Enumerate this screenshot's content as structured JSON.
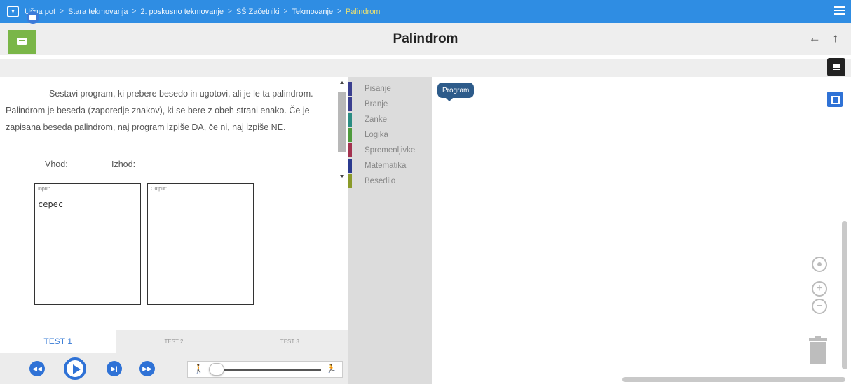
{
  "breadcrumb": {
    "toggle_icon": "chevron-down-icon",
    "items": [
      "Učna pot",
      "Stara tekmovanja",
      "2. poskusno tekmovanje",
      "SŠ Začetniki",
      "Tekmovanje",
      "Palindrom"
    ],
    "separator": ">"
  },
  "header": {
    "title": "Palindrom",
    "nav": "← ↑",
    "accent": "#2f8de3",
    "logo_color": "#7ab648"
  },
  "task": {
    "text": "Sestavi program, ki prebere besedo in ugotovi, ali je le ta palindrom. Palindrom je beseda (zaporedje znakov), ki se bere z obeh strani enako. Če je zapisana beseda palindrom, naj program izpiše DA, če ni, naj izpiše NE.",
    "input_label": "Vhod:",
    "output_label": "Izhod:",
    "input_caption": "Input:",
    "input_value": "cepec",
    "output_caption": "Output:"
  },
  "tabs": [
    {
      "label": "TEST 1",
      "active": true
    },
    {
      "label": "TEST 2",
      "active": false
    },
    {
      "label": "TEST 3",
      "active": false
    }
  ],
  "controls": {
    "first": "first-step-icon",
    "play": "play-icon",
    "step": "step-icon",
    "last": "last-step-icon",
    "slow_icon": "🚶",
    "fast_icon": "🏃",
    "speed": 0.1
  },
  "toolbox": {
    "categories": [
      {
        "label": "Pisanje",
        "color": "#3b3f8f"
      },
      {
        "label": "Branje",
        "color": "#3b3f8f"
      },
      {
        "label": "Zanke",
        "color": "#2a8c82"
      },
      {
        "label": "Logika",
        "color": "#4e9a3c"
      },
      {
        "label": "Spremenljivke",
        "color": "#a3324f"
      },
      {
        "label": "Matematika",
        "color": "#2b3a8f"
      },
      {
        "label": "Besedilo",
        "color": "#8a9a2a"
      }
    ]
  },
  "workspace": {
    "program_block": "Program"
  }
}
